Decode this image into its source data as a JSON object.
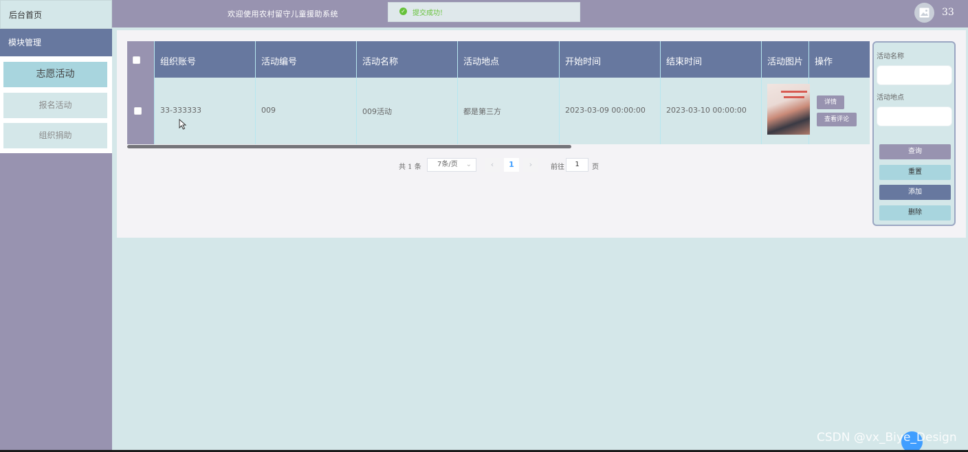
{
  "sidebar": {
    "home_label": "后台首页",
    "module_label": "模块管理",
    "items": [
      {
        "label": "志愿活动",
        "active": true
      },
      {
        "label": "报名活动",
        "active": false
      },
      {
        "label": "组织捐助",
        "active": false
      }
    ]
  },
  "header": {
    "title": "欢迎使用农村留守儿童援助系统",
    "toast": "提交成功!",
    "user": "33"
  },
  "table": {
    "columns": [
      "组织账号",
      "活动编号",
      "活动名称",
      "活动地点",
      "开始时间",
      "结束时间",
      "活动图片",
      "操作"
    ],
    "rows": [
      {
        "account": "33-333333",
        "code": "009",
        "name": "009活动",
        "location": "都是第三方",
        "start": "2023-03-09 00:00:00",
        "end": "2023-03-10 00:00:00",
        "detail_label": "详情",
        "comment_label": "查看评论"
      }
    ]
  },
  "pagination": {
    "total": "共 1 条",
    "page_size": "7条/页",
    "current": "1",
    "goto_label": "前往",
    "goto_value": "1",
    "page_suffix": "页"
  },
  "search": {
    "name_label": "活动名称",
    "location_label": "活动地点",
    "query_label": "查询",
    "reset_label": "重置",
    "add_label": "添加",
    "delete_label": "删除"
  },
  "watermark": "CSDN @vx_Biye_Design",
  "colors": {
    "purple": "#9893b0",
    "navy": "#67789f",
    "teal": "#a8d5de",
    "bg": "#d4e7e9",
    "success": "#67c23a",
    "link": "#409eff"
  }
}
